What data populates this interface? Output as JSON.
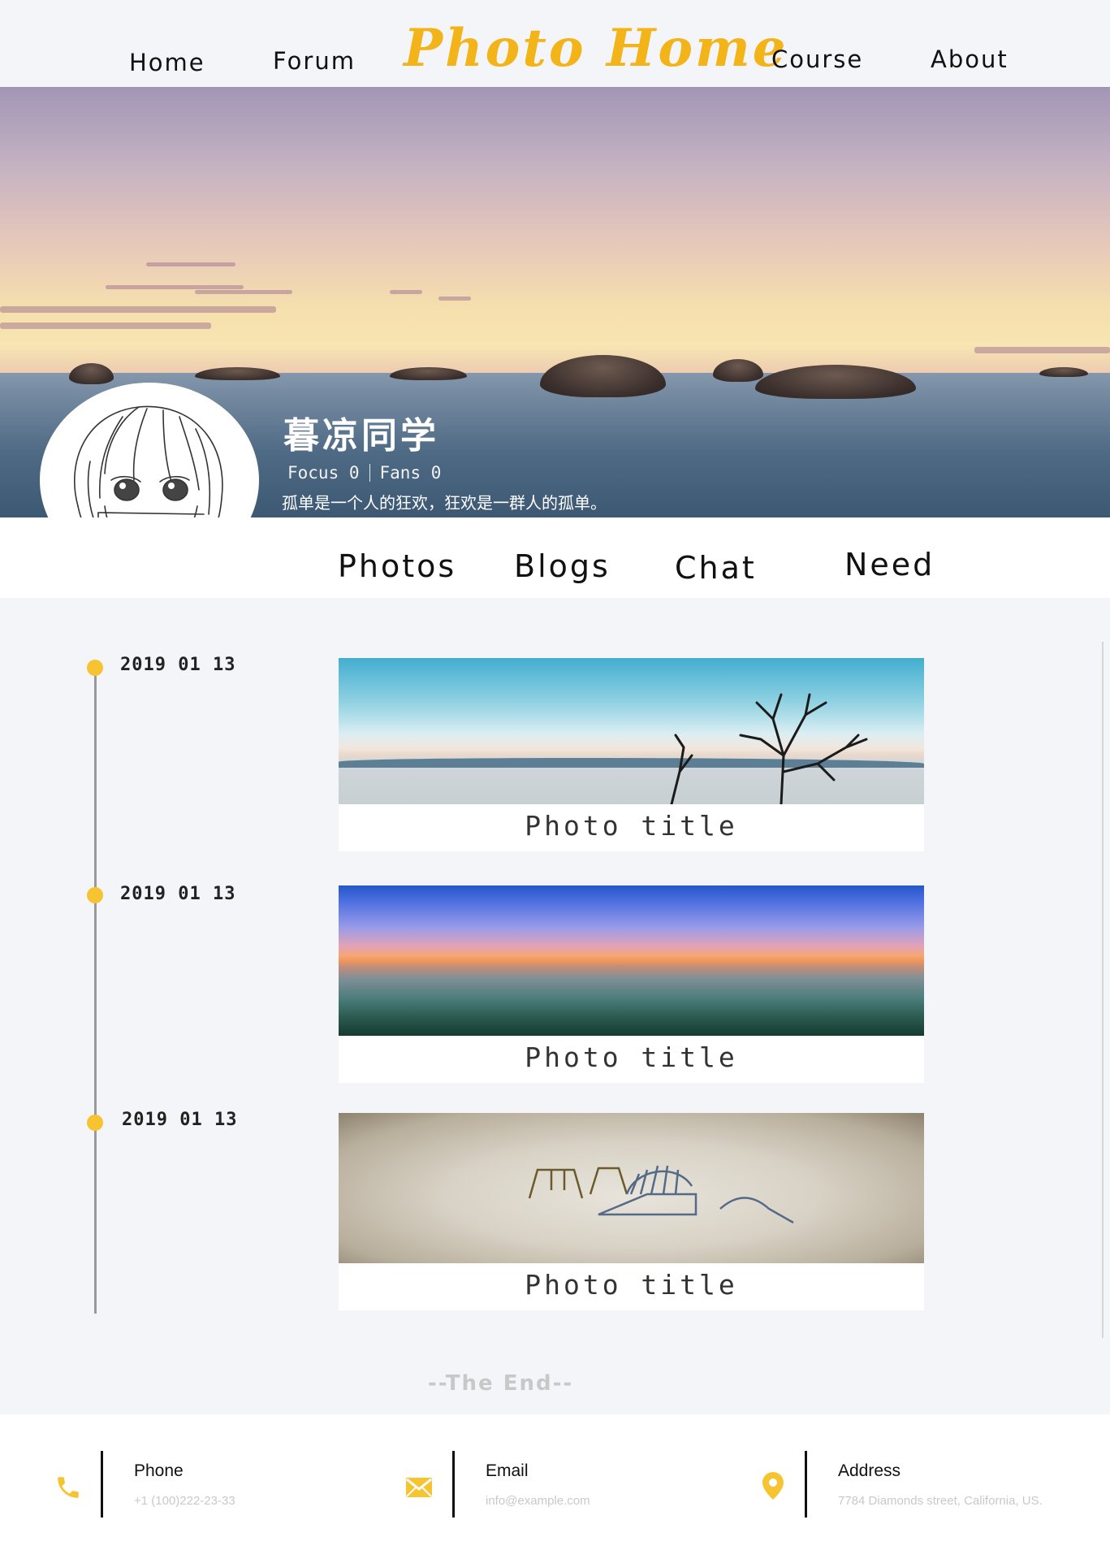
{
  "nav": {
    "home": "Home",
    "forum": "Forum",
    "brand": "Photo Home",
    "course": "Course",
    "about": "About"
  },
  "profile": {
    "name": "暮凉同学",
    "focus": "Focus 0",
    "fans": "Fans 0",
    "bio": "孤单是一个人的狂欢，狂欢是一群人的孤单。"
  },
  "tabs": {
    "photos": "Photos",
    "blogs": "Blogs",
    "chat": "Chat",
    "need": "Need"
  },
  "timeline": [
    {
      "date": "2019 01 13",
      "title": "Photo title"
    },
    {
      "date": "2019 01 13",
      "title": "Photo title"
    },
    {
      "date": "2019 01 13",
      "title": "Photo title"
    }
  ],
  "end_text": "--The End--",
  "footer": {
    "phone_label": "Phone",
    "phone_value": "+1 (100)222-23-33",
    "email_label": "Email",
    "email_value": "info@example.com",
    "address_label": "Address",
    "address_value": "7784 Diamonds street, California, US."
  },
  "colors": {
    "accent": "#f7c431",
    "brand": "#f3b41a"
  }
}
